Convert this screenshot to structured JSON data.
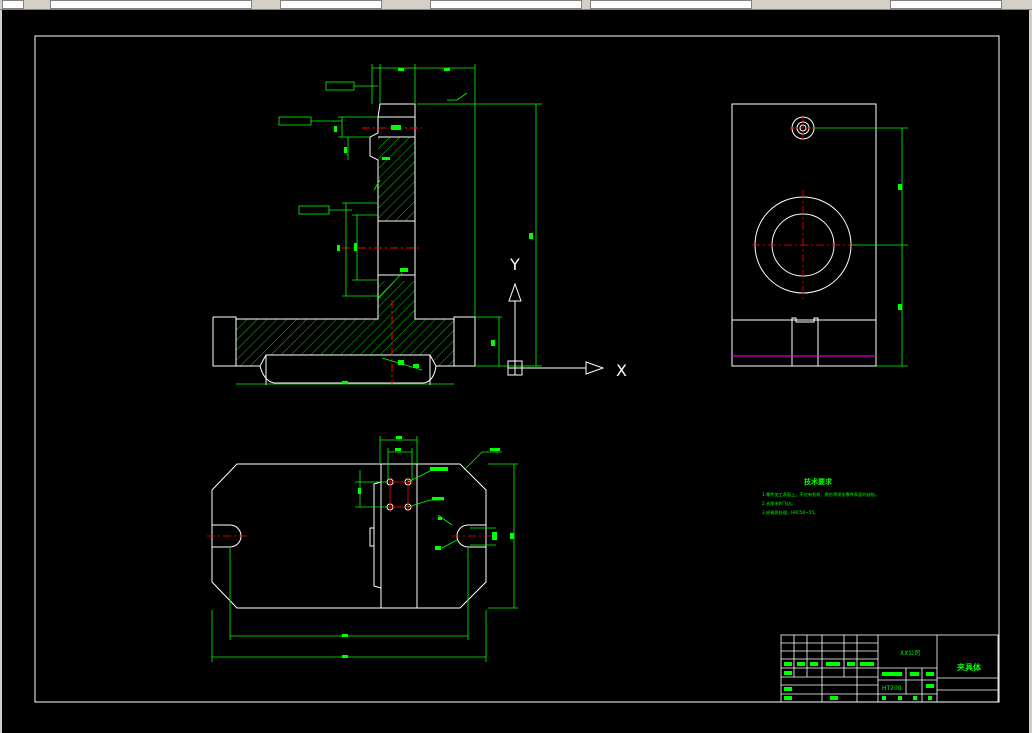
{
  "toolbar": {
    "field_count": 6
  },
  "drawing": {
    "axes": {
      "x_label": "X",
      "y_label": "Y"
    },
    "technical_requirements": {
      "title": "技术要求",
      "lines": [
        "1.零件加工表面上，不应有划痕、擦伤等损伤零件表面的缺陷。",
        "2.去除毛刺飞边。",
        "3.经调质处理，HRC50~55。"
      ]
    },
    "title_block": {
      "part_name": "夹具体",
      "org_label": "XX公司",
      "material_label": "HT200"
    },
    "colors": {
      "background": "#000000",
      "outline": "#ffffff",
      "dimension": "#00ff00",
      "centerline": "#ff0000",
      "hatch": "#00ff00",
      "highlight": "#ff00ff"
    }
  }
}
